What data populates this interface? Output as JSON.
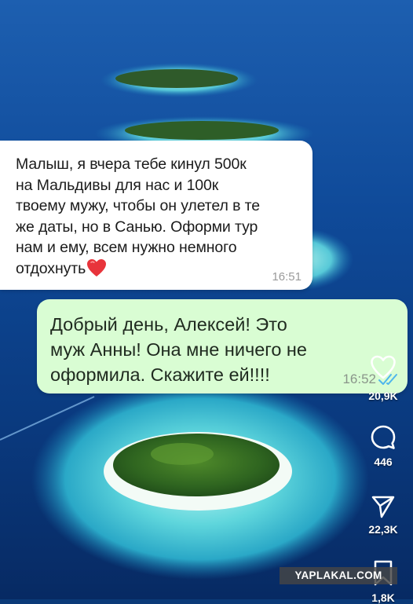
{
  "messages": {
    "incoming": {
      "lines": [
        "Малыш, я вчера тебе кинул 500к",
        "на Мальдивы для нас и 100к",
        "твоему мужу, чтобы он улетел в те",
        "же даты, но в Санью. Оформи тур",
        "нам и ему, всем нужно немного",
        "отдохнуть"
      ],
      "emoji": "heart-emoji",
      "time": "16:51"
    },
    "outgoing": {
      "lines": [
        "Добрый день, Алексей! Это",
        "муж Анны! Она мне ничего не",
        "оформила. Скажите ей!!!!"
      ],
      "time": "16:52",
      "status_icon": "double-check-icon",
      "status_color": "#4fb6ec"
    }
  },
  "actions": {
    "like_count": "20,9K",
    "comment_count": "446",
    "share_count": "22,3K",
    "bookmark_count": "1,8K"
  },
  "watermark": "YAPLAKAL.COM",
  "colors": {
    "incoming_bubble": "#ffffff",
    "outgoing_bubble": "#d9fdd3",
    "ocean": "#0b3a78"
  }
}
